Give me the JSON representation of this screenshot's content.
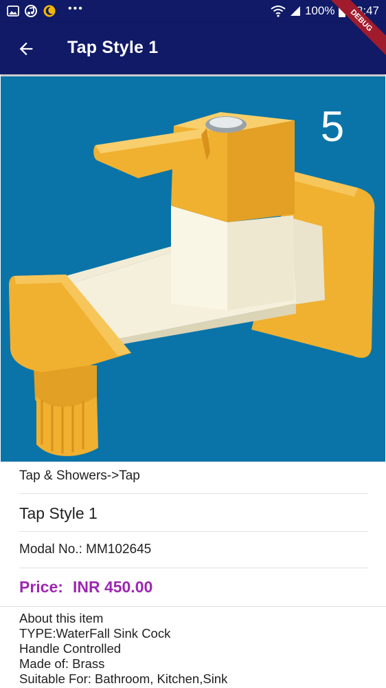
{
  "status_bar": {
    "battery": "100%",
    "time": "08:47"
  },
  "app_bar": {
    "title": "Tap Style 1",
    "debug_banner": "DEBUG"
  },
  "hero_image": {
    "badge_number": "5",
    "background_color": "#0a74a8",
    "accent_color": "#f0b030"
  },
  "product": {
    "breadcrumb": "Tap & Showers->Tap",
    "name": "Tap Style 1",
    "model": "Modal No.: MM102645",
    "price_label": "Price:",
    "price_value": "INR 450.00",
    "price_color": "#9c27b0",
    "about": [
      "About this item",
      "TYPE:WaterFall Sink Cock",
      "Handle Controlled",
      "Made of: Brass",
      "Suitable For: Bathroom, Kitchen,Sink"
    ]
  }
}
